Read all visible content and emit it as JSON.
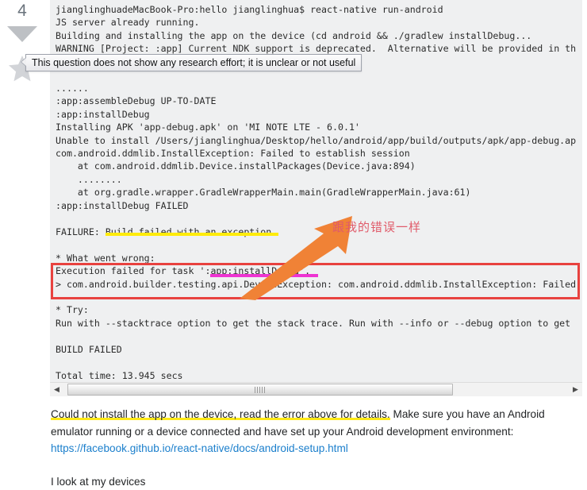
{
  "vote": {
    "count": "4",
    "downvote_icon": "downvote-triangle-icon",
    "favorite_icon": "star-icon"
  },
  "tooltip": {
    "text": "This question does not show any research effort; it is unclear or not useful"
  },
  "code_block": {
    "language": "shell-output",
    "background": "#eff0f1",
    "text": "jianglinghuadeMacBook-Pro:hello jianglinghua$ react-native run-android\nJS server already running.\nBuilding and installing the app on the device (cd android && ./gradlew installDebug...\nWARNING [Project: :app] Current NDK support is deprecated.  Alternative will be provided in th\n\n\n......\n:app:assembleDebug UP-TO-DATE\n:app:installDebug\nInstalling APK 'app-debug.apk' on 'MI NOTE LTE - 6.0.1'\nUnable to install /Users/jianglinghua/Desktop/hello/android/app/build/outputs/apk/app-debug.ap\ncom.android.ddmlib.InstallException: Failed to establish session\n    at com.android.ddmlib.Device.installPackages(Device.java:894)\n    ........\n    at org.gradle.wrapper.GradleWrapperMain.main(GradleWrapperMain.java:61)\n:app:installDebug FAILED\n\nFAILURE: Build failed with an exception.\n\n* What went wrong:\nExecution failed for task ':app:installDebug'.\n> com.android.builder.testing.api.DeviceException: com.android.ddmlib.InstallException: Failed\n\n* Try:\nRun with --stacktrace option to get the stack trace. Run with --info or --debug option to get\n\nBUILD FAILED\n\nTotal time: 13.945 secs"
  },
  "annotations": {
    "note_text": "跟我的错误一样",
    "note_color": "#e05b6a",
    "arrow_color": "#f08236",
    "red_box_color": "#e8423f",
    "yellow_highlight_color": "#ffeb0a",
    "magenta_underline_color": "#ee34d2"
  },
  "scrollbar": {
    "left_arrow_icon": "chevron-left-icon",
    "right_arrow_icon": "chevron-right-icon",
    "orientation": "horizontal"
  },
  "post_body": {
    "highlighted_sentence": "Could not install the app on the device, read the error above for details.",
    "rest_of_paragraph": " Make sure you have an Android emulator running or a device connected and have set up your Android development environment: ",
    "link_text": "https://facebook.github.io/react-native/docs/android-setup.html",
    "link_color": "#1b7fcc",
    "paragraph_2": "I look at my devices"
  }
}
